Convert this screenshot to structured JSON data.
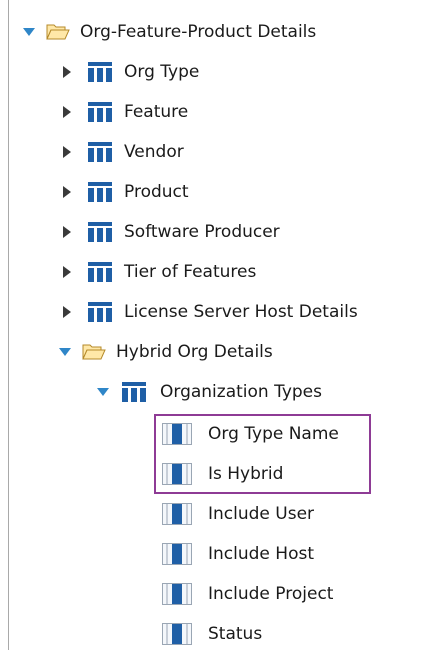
{
  "tree": {
    "root": {
      "label": "Org-Feature-Product Details"
    },
    "children": [
      {
        "label": "Org Type"
      },
      {
        "label": "Feature"
      },
      {
        "label": "Vendor"
      },
      {
        "label": "Product"
      },
      {
        "label": "Software Producer"
      },
      {
        "label": "Tier of Features"
      },
      {
        "label": "License Server Host Details"
      }
    ],
    "hybrid": {
      "label": "Hybrid Org Details",
      "table": {
        "label": "Organization Types",
        "columns": [
          {
            "label": "Org Type Name"
          },
          {
            "label": "Is Hybrid"
          },
          {
            "label": "Include User"
          },
          {
            "label": "Include Host"
          },
          {
            "label": "Include Project"
          },
          {
            "label": "Status"
          }
        ]
      }
    }
  },
  "colors": {
    "expand_arrow": "#2f86c8",
    "collapse_arrow": "#3a3a3a",
    "folder_fill": "#ffe8a8",
    "folder_stroke": "#b58a2a",
    "table_icon": "#1f5fa6",
    "highlight_border": "#8e3b95"
  },
  "icons": [
    "expand-arrow-icon",
    "collapse-arrow-icon",
    "folder-open-icon",
    "table-icon",
    "column-icon"
  ]
}
